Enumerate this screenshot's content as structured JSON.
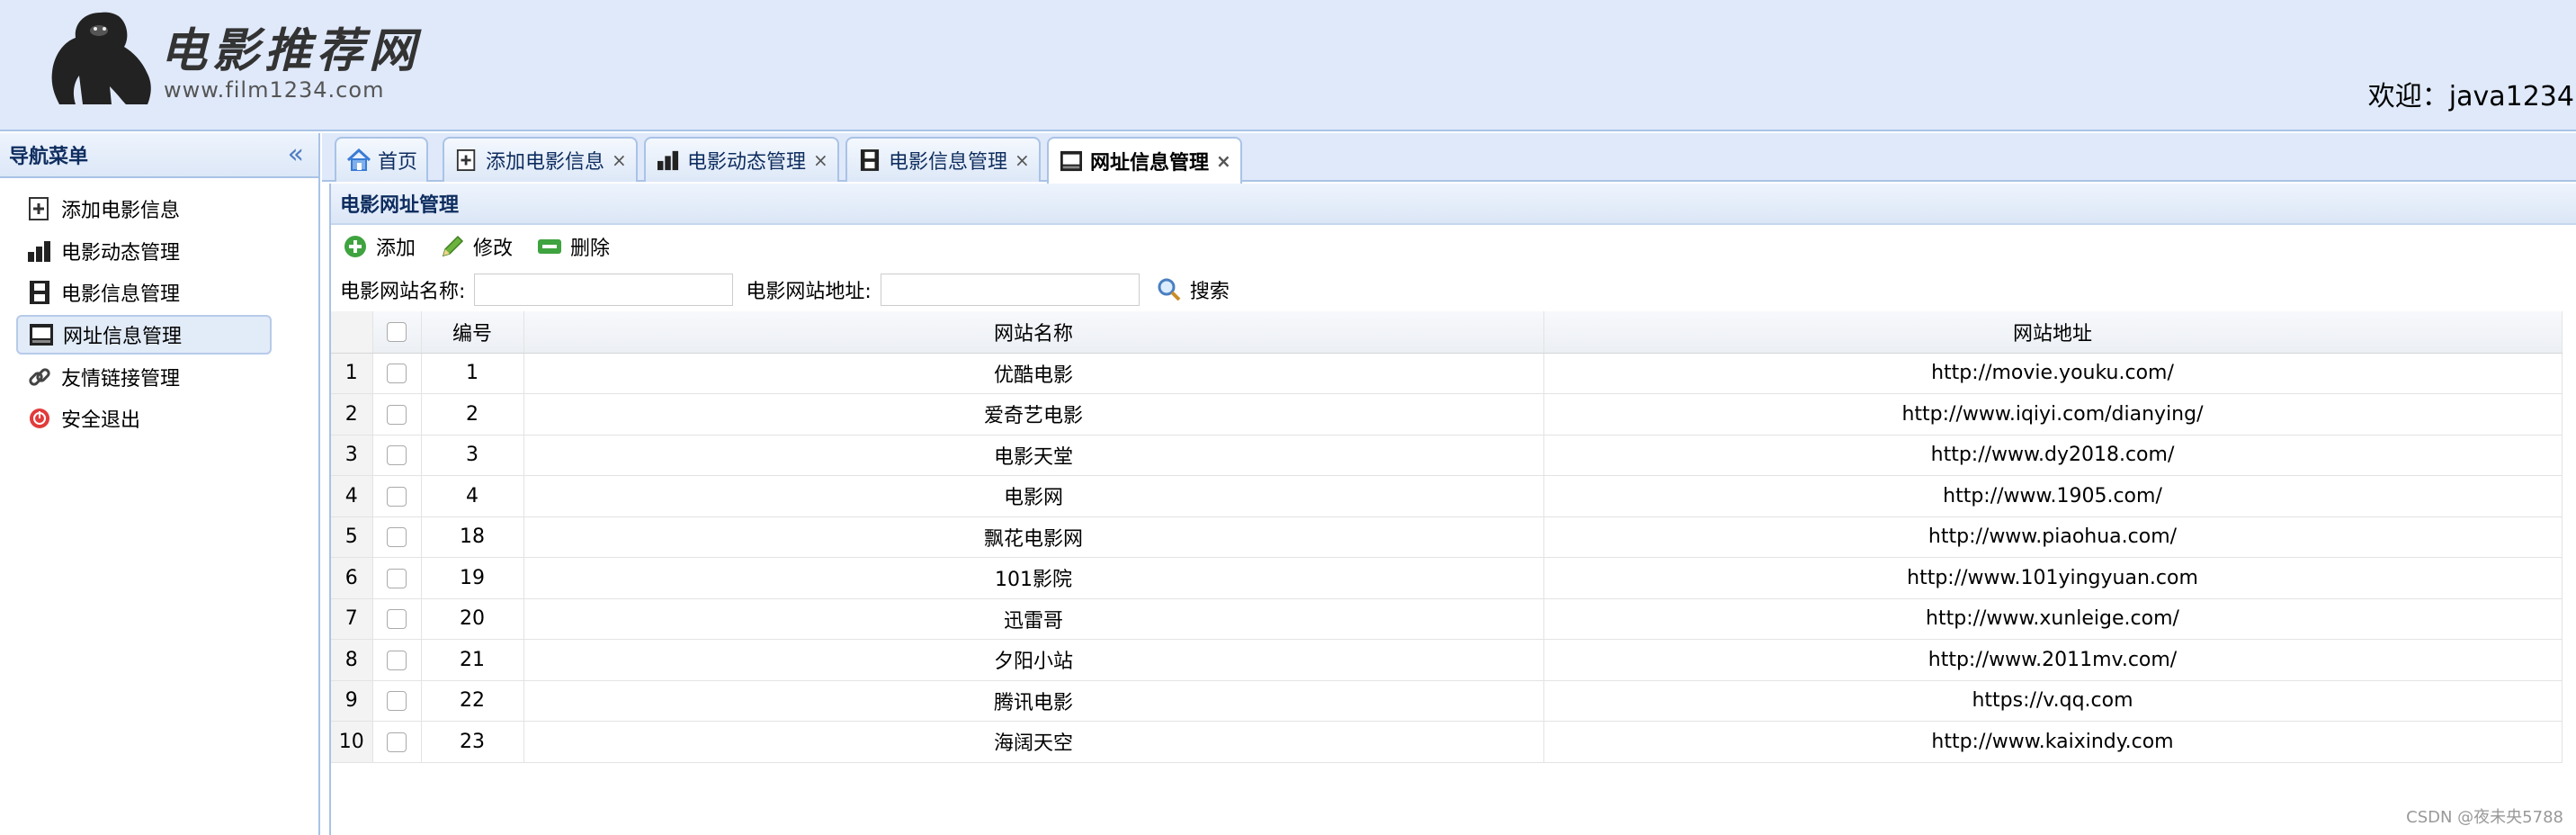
{
  "header": {
    "logo_title": "电影推荐网",
    "logo_url": "www.film1234.com",
    "welcome": "欢迎：java1234"
  },
  "nav": {
    "title": "导航菜单",
    "items": [
      {
        "label": "添加电影信息",
        "icon": "add-document-icon"
      },
      {
        "label": "电影动态管理",
        "icon": "bar-chart-icon"
      },
      {
        "label": "电影信息管理",
        "icon": "film-icon"
      },
      {
        "label": "网址信息管理",
        "icon": "monitor-icon"
      },
      {
        "label": "友情链接管理",
        "icon": "link-icon"
      },
      {
        "label": "安全退出",
        "icon": "exit-icon"
      }
    ]
  },
  "tabs": [
    {
      "label": "首页",
      "icon": "home-icon"
    },
    {
      "label": "添加电影信息",
      "icon": "add-document-icon"
    },
    {
      "label": "电影动态管理",
      "icon": "bar-chart-icon"
    },
    {
      "label": "电影信息管理",
      "icon": "film-icon"
    },
    {
      "label": "网址信息管理",
      "icon": "monitor-icon"
    }
  ],
  "panel": {
    "title": "电影网址管理",
    "toolbar": {
      "add": "添加",
      "edit": "修改",
      "delete": "删除"
    },
    "search": {
      "name_label": "电影网站名称:",
      "url_label": "电影网站地址:",
      "name_value": "",
      "url_value": "",
      "button": "搜索"
    }
  },
  "table": {
    "columns": [
      "编号",
      "网站名称",
      "网站地址"
    ],
    "rows": [
      {
        "n": "1",
        "id": "1",
        "name": "优酷电影",
        "url": "http://movie.youku.com/"
      },
      {
        "n": "2",
        "id": "2",
        "name": "爱奇艺电影",
        "url": "http://www.iqiyi.com/dianying/"
      },
      {
        "n": "3",
        "id": "3",
        "name": "电影天堂",
        "url": "http://www.dy2018.com/"
      },
      {
        "n": "4",
        "id": "4",
        "name": "电影网",
        "url": "http://www.1905.com/"
      },
      {
        "n": "5",
        "id": "18",
        "name": "飘花电影网",
        "url": "http://www.piaohua.com/"
      },
      {
        "n": "6",
        "id": "19",
        "name": "101影院",
        "url": "http://www.101yingyuan.com"
      },
      {
        "n": "7",
        "id": "20",
        "name": "迅雷哥",
        "url": "http://www.xunleige.com/"
      },
      {
        "n": "8",
        "id": "21",
        "name": "夕阳小站",
        "url": "http://www.2011mv.com/"
      },
      {
        "n": "9",
        "id": "22",
        "name": "腾讯电影",
        "url": "https://v.qq.com"
      },
      {
        "n": "10",
        "id": "23",
        "name": "海阔天空",
        "url": "http://www.kaixindy.com"
      }
    ]
  },
  "watermark": "CSDN @夜未央5788"
}
